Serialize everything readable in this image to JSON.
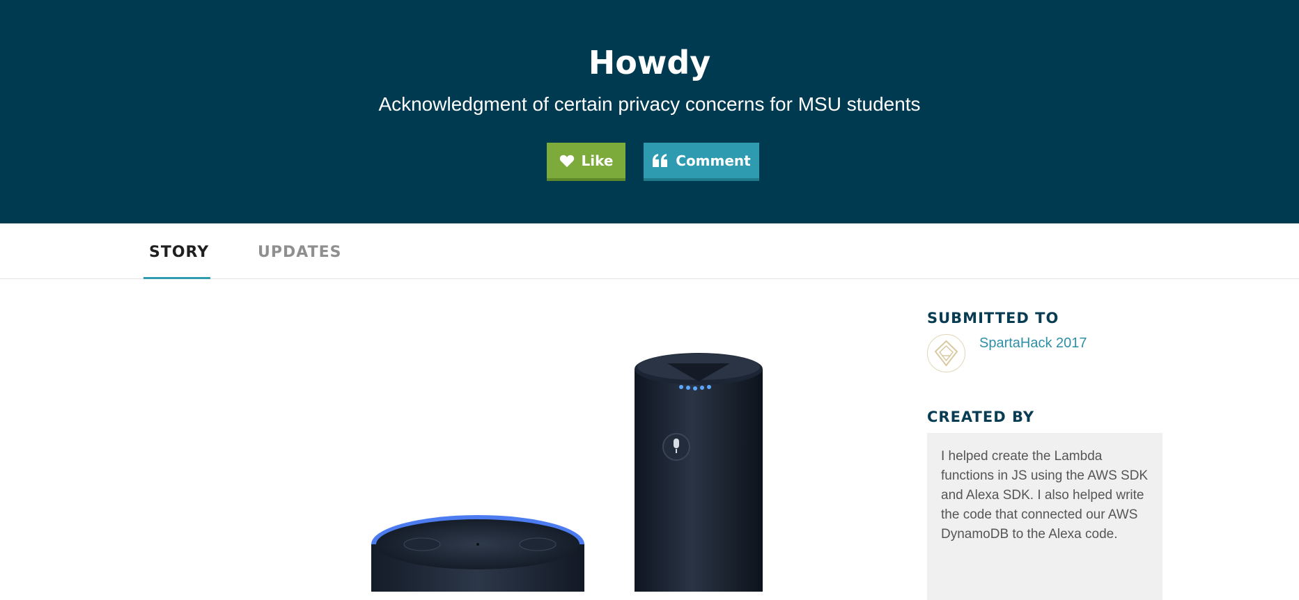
{
  "hero": {
    "title": "Howdy",
    "subtitle": "Acknowledgment of certain privacy concerns for MSU students",
    "like_label": "Like",
    "comment_label": "Comment",
    "like_icon": "heart-icon",
    "comment_icon": "quote-icon",
    "background_color": "#003a50",
    "like_color": "#7cab3c",
    "comment_color": "#2e9bb0"
  },
  "tabs": [
    {
      "label": "STORY",
      "active": true
    },
    {
      "label": "UPDATES",
      "active": false
    }
  ],
  "sidebar": {
    "submitted_heading": "SUBMITTED TO",
    "submitted_link": "SpartaHack 2017",
    "created_heading": "CREATED BY",
    "creator_description": "I helped create the Lambda functions in JS using the AWS SDK and Alexa SDK. I also helped write the code that connected our AWS DynamoDB to the Alexa code."
  },
  "media": {
    "image_subject": "amazon-echo-devices"
  }
}
